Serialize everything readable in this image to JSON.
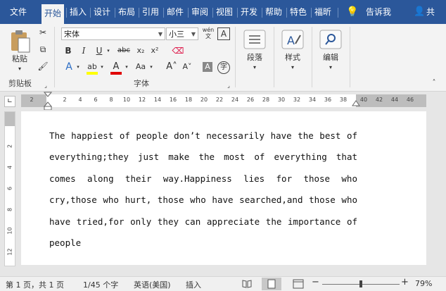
{
  "ribbon_tabs": [
    "文件",
    "开始",
    "插入",
    "设计",
    "布局",
    "引用",
    "邮件",
    "审阅",
    "视图",
    "开发",
    "帮助",
    "特色",
    "福昕"
  ],
  "active_tab": "开始",
  "tell_me": "告诉我",
  "share": "共",
  "clipboard": {
    "paste_label": "粘贴",
    "group_label": "剪贴板"
  },
  "font": {
    "name": "宋体",
    "size": "小三",
    "group_label": "字体",
    "format_buttons": [
      "B",
      "I",
      "U",
      "abc",
      "x₂",
      "x²"
    ],
    "aa_label": "Aa",
    "wen_label": "wén"
  },
  "paragraph": {
    "label": "段落"
  },
  "styles": {
    "label": "样式"
  },
  "editing": {
    "label": "编辑"
  },
  "ruler": {
    "left_marker": "2",
    "ticks": [
      "2",
      "4",
      "6",
      "8",
      "10",
      "12",
      "14",
      "16",
      "18",
      "20",
      "22",
      "24",
      "26",
      "28",
      "30",
      "32",
      "34",
      "36",
      "38",
      "40",
      "42",
      "44",
      "46"
    ]
  },
  "vruler": [
    "2",
    "4",
    "6",
    "8",
    "10",
    "12"
  ],
  "document": {
    "text": "The happiest of people don’t necessarily have the best of everything;they just make the most of everything that comes along their way.Happiness lies for those who cry,those who hurt, those who have searched,and those who have tried,for only they can appreciate the importance of people"
  },
  "status": {
    "page": "第 1 页，共 1 页",
    "words": "1/45 个字",
    "language": "英语(美国)",
    "mode": "插入",
    "zoom": "79%"
  },
  "colors": {
    "ribbon_blue": "#2b579a",
    "highlight_yellow": "#ffff00",
    "font_red": "#e00000"
  }
}
